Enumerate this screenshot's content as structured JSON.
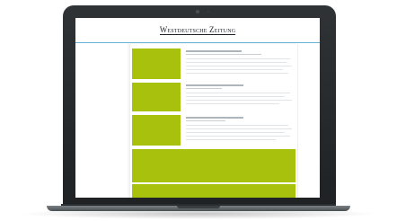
{
  "newspaper": {
    "title": "Westdeutsche Zeitung"
  },
  "colors": {
    "accent_green": "#a7c10c",
    "blue_rule": "#67b3d6",
    "laptop_frame": "#2a2d30"
  },
  "icons": [
    "camera-icon"
  ]
}
